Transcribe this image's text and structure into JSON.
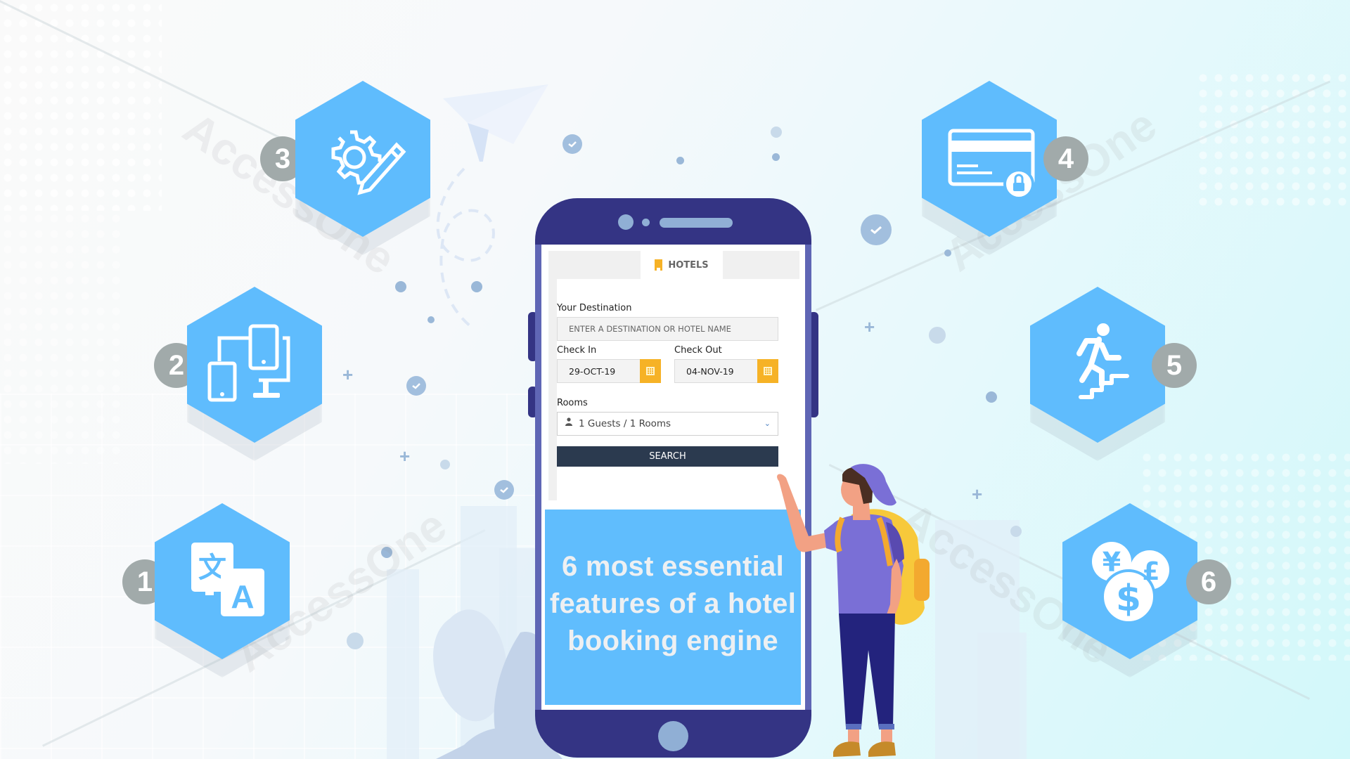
{
  "headline": {
    "line1": "6 most essential",
    "line2": "features of a hotel",
    "line3": "booking engine"
  },
  "watermark": "AccessOne",
  "booking_form": {
    "tab_label": "HOTELS",
    "tab_icon": "hotel-building-icon",
    "destination_label": "Your Destination",
    "destination_placeholder": "ENTER A DESTINATION OR HOTEL NAME",
    "checkin_label": "Check In",
    "checkin_value": "29-OCT-19",
    "checkout_label": "Check Out",
    "checkout_value": "04-NOV-19",
    "rooms_label": "Rooms",
    "rooms_value": "1 Guests / 1 Rooms",
    "search_label": "SEARCH"
  },
  "features": [
    {
      "number": "1",
      "icon": "translate-language-icon"
    },
    {
      "number": "2",
      "icon": "responsive-devices-icon"
    },
    {
      "number": "3",
      "icon": "gear-pencil-customize-icon"
    },
    {
      "number": "4",
      "icon": "secure-credit-card-icon"
    },
    {
      "number": "5",
      "icon": "person-climbing-stairs-icon"
    },
    {
      "number": "6",
      "icon": "multi-currency-icon"
    }
  ],
  "colors": {
    "hex_blue": "#5fbcfd",
    "badge_gray": "#a1aaaa",
    "phone_dark": "#343484",
    "phone_frame": "#5f66b5",
    "accent_yellow": "#f6b226",
    "search_button": "#2b3a4f"
  }
}
